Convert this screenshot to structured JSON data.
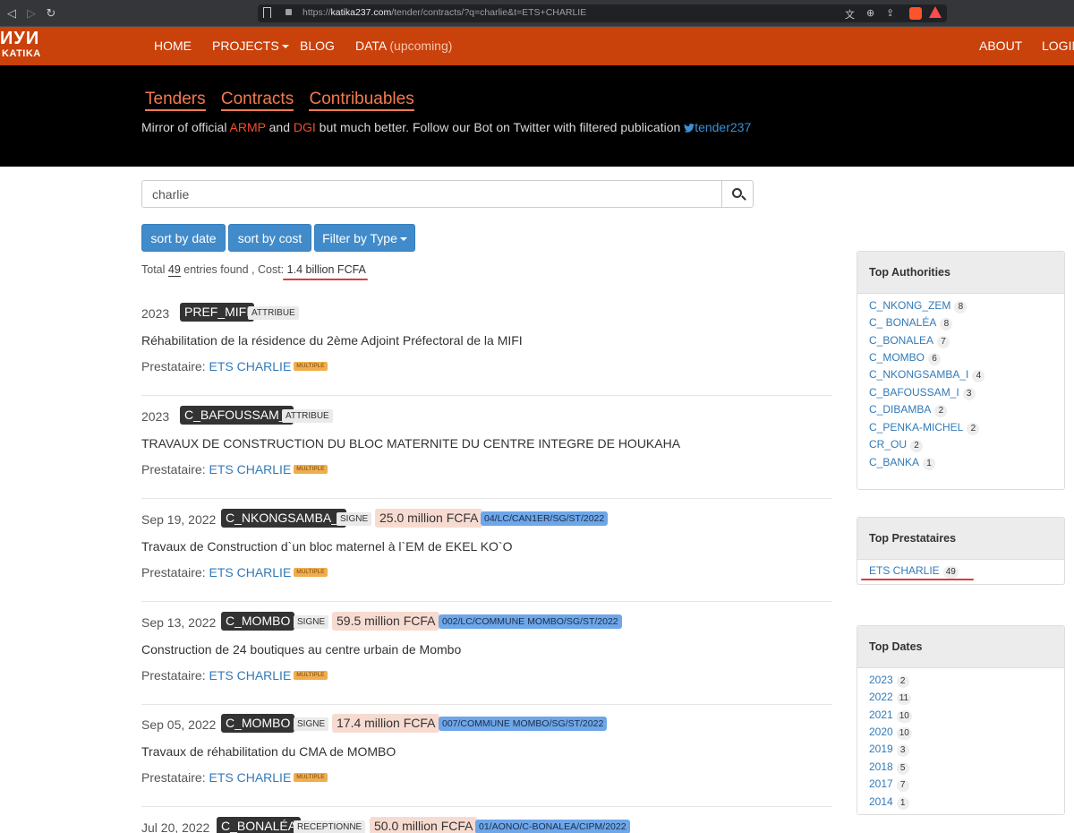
{
  "browser": {
    "url_prefix": "https://",
    "url_domain": "katika237.com",
    "url_path": "/tender/contracts/?q=charlie&t=ETS+CHARLIE"
  },
  "nav": {
    "logo_top": "ИУИ",
    "logo_bottom": "KATIKA",
    "home": "HOME",
    "projects": "PROJECTS",
    "blog": "BLOG",
    "data": "DATA",
    "data_note": "(upcoming)",
    "about": "ABOUT",
    "login": "LOGIN"
  },
  "hero": {
    "link_tenders": "Tenders",
    "link_contracts": "Contracts",
    "link_contribuables": "Contribuables",
    "tag_1": "Mirror of official ",
    "tag_armp": "ARMP",
    "tag_2": " and ",
    "tag_dgi": "DGI",
    "tag_3": " but much better. Follow our Bot on Twitter with filtered publication ",
    "tag_handle": "tender237"
  },
  "search": {
    "value": "charlie"
  },
  "buttons": {
    "sort_date": "sort by date",
    "sort_cost": "sort by cost",
    "filter": "Filter by Type"
  },
  "summary": {
    "total_label": "Total",
    "total": "49",
    "found": "entries found , Cost:",
    "cost": "1.4 billion FCFA"
  },
  "prest_label": "Prestataire:",
  "results": [
    {
      "date": "2023",
      "authority": "PREF_MIFI",
      "status": "ATTRIBUE",
      "cost": "",
      "ref": "",
      "title": "Réhabilitation de la résidence du 2ème Adjoint Préfectoral de la MIFI",
      "prestataire": "ETS CHARLIE",
      "badge": "MULTIPLE"
    },
    {
      "date": "2023",
      "authority": "C_BAFOUSSAM_I",
      "status": "ATTRIBUE",
      "cost": "",
      "ref": "",
      "title": "TRAVAUX DE CONSTRUCTION DU BLOC MATERNITE DU CENTRE INTEGRE DE HOUKAHA",
      "prestataire": "ETS CHARLIE",
      "badge": "MULTIPLE"
    },
    {
      "date": "Sep 19, 2022",
      "authority": "C_NKONGSAMBA_I",
      "status": "SIGNE",
      "cost": "25.0 million FCFA",
      "ref": "04/LC/CAN1ER/SG/ST/2022",
      "title": "Travaux de Construction d`un bloc maternel à l`EM de EKEL KO`O",
      "prestataire": "ETS CHARLIE",
      "badge": "MULTIPLE"
    },
    {
      "date": "Sep 13, 2022",
      "authority": "C_MOMBO",
      "status": "SIGNE",
      "cost": "59.5 million FCFA",
      "ref": "002/LC/COMMUNE MOMBO/SG/ST/2022",
      "title": "Construction de 24 boutiques au centre urbain de Mombo",
      "prestataire": "ETS CHARLIE",
      "badge": "MULTIPLE"
    },
    {
      "date": "Sep 05, 2022",
      "authority": "C_MOMBO",
      "status": "SIGNE",
      "cost": "17.4 million FCFA",
      "ref": "007/COMMUNE MOMBO/SG/ST/2022",
      "title": "Travaux de réhabilitation du CMA de MOMBO",
      "prestataire": "ETS CHARLIE",
      "badge": "MULTIPLE"
    },
    {
      "date": "Jul 20, 2022",
      "authority": "C_BONALÉA",
      "status": "RECEPTIONNE",
      "cost": "50.0 million FCFA",
      "ref": "01/AONO/C-BONALEA/CIPM/2022",
      "title": "",
      "prestataire": "",
      "badge": ""
    }
  ],
  "sidebar": {
    "authorities_title": "Top Authorities",
    "authorities": [
      {
        "name": "C_NKONG_ZEM",
        "count": "8"
      },
      {
        "name": "C_ BONALÉA",
        "count": "8"
      },
      {
        "name": "C_BONALEA",
        "count": "7"
      },
      {
        "name": "C_MOMBO",
        "count": "6"
      },
      {
        "name": "C_NKONGSAMBA_I",
        "count": "4"
      },
      {
        "name": "C_BAFOUSSAM_I",
        "count": "3"
      },
      {
        "name": "C_DIBAMBA",
        "count": "2"
      },
      {
        "name": "C_PENKA-MICHEL",
        "count": "2"
      },
      {
        "name": "CR_OU",
        "count": "2"
      },
      {
        "name": "C_BANKA",
        "count": "1"
      }
    ],
    "prestataires_title": "Top Prestataires",
    "prestataires": [
      {
        "name": "ETS CHARLIE",
        "count": "49"
      }
    ],
    "dates_title": "Top Dates",
    "dates": [
      {
        "name": "2023",
        "count": "2"
      },
      {
        "name": "2022",
        "count": "11"
      },
      {
        "name": "2021",
        "count": "10"
      },
      {
        "name": "2020",
        "count": "10"
      },
      {
        "name": "2019",
        "count": "3"
      },
      {
        "name": "2018",
        "count": "5"
      },
      {
        "name": "2017",
        "count": "7"
      },
      {
        "name": "2014",
        "count": "1"
      }
    ]
  },
  "colors": {
    "nav_bg": "#c9410b",
    "link": "#337ab7",
    "accent_red": "#e03b3b",
    "btn": "#428bca"
  }
}
